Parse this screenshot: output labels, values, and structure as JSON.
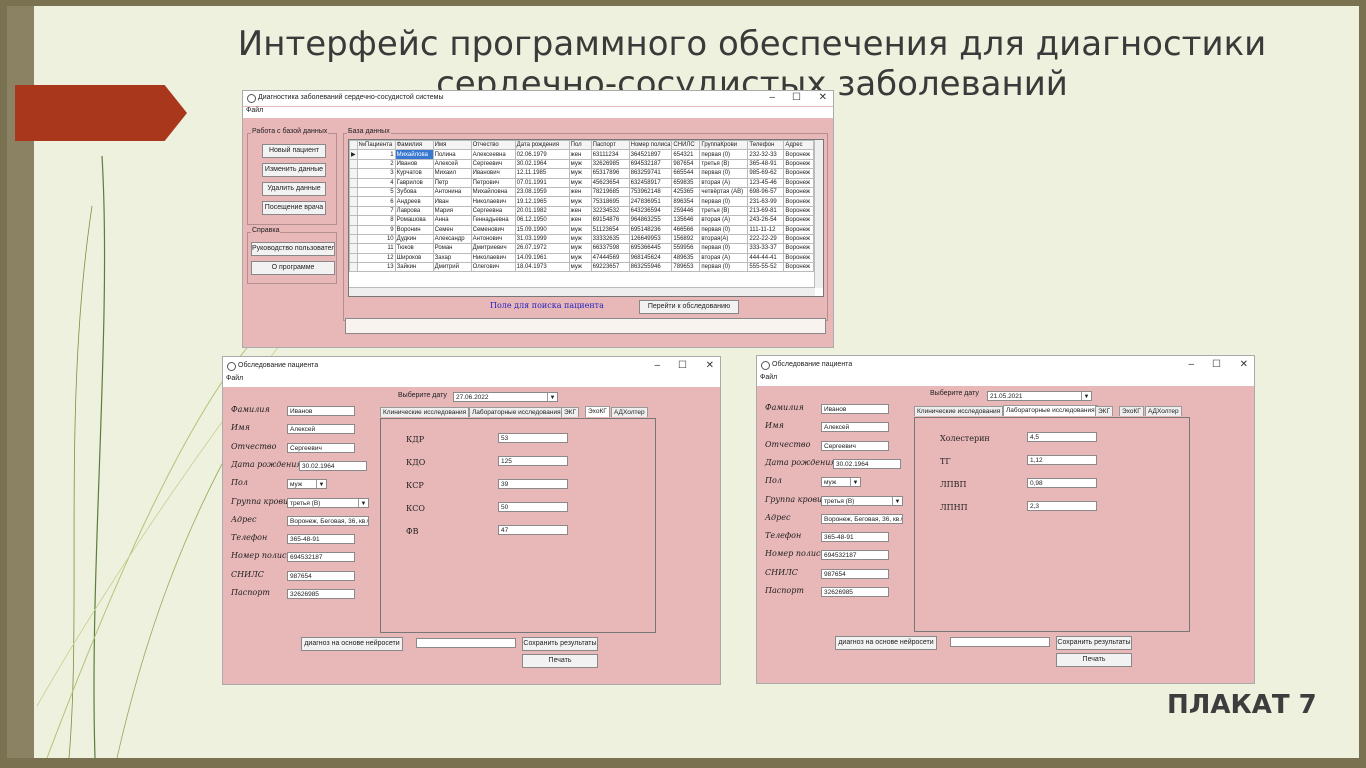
{
  "slide": {
    "title_line1": "Интерфейс программного обеспечения для диагностики",
    "title_line2": "сердечно-сосудистых заболеваний",
    "plakat": "ПЛАКАТ 7"
  },
  "main_window": {
    "title": "Диагностика заболеваний сердечно-сосудистой системы",
    "menu_file": "Файл",
    "db_group": "Работа с базой данных",
    "btn_new": "Новый пациент",
    "btn_edit": "Изменить данные",
    "btn_delete": "Удалить данные",
    "btn_visit": "Посещение врача",
    "help_group": "Справка",
    "btn_manual": "Руководство пользователя",
    "btn_about": "О программе",
    "grid_label": "База данных",
    "columns": [
      "№Пациента",
      "Фамилия",
      "Имя",
      "Отчество",
      "Дата рождения",
      "Пол",
      "Паспорт",
      "Номер полиса",
      "СНИЛС",
      "ГруппаКрови",
      "Телефон",
      "Адрес"
    ],
    "rows": [
      [
        "1",
        "Михайлова",
        "Полина",
        "Алексеевна",
        "02.06.1979",
        "жен",
        "63111234",
        "364521897",
        "654321",
        "первая (0)",
        "232-32-33",
        "Воронеж"
      ],
      [
        "2",
        "Иванов",
        "Алексей",
        "Сергеевич",
        "30.02.1964",
        "муж",
        "32626985",
        "694532187",
        "987654",
        "третья (B)",
        "365-48-91",
        "Воронеж"
      ],
      [
        "3",
        "Курчатов",
        "Михаил",
        "Иванович",
        "12.11.1985",
        "муж",
        "65317896",
        "863259741",
        "665544",
        "первая (0)",
        "985-69-62",
        "Воронеж"
      ],
      [
        "4",
        "Гаврилов",
        "Петр",
        "Петрович",
        "07.01.1991",
        "муж",
        "45623654",
        "632458917",
        "659835",
        "вторая (A)",
        "123-45-46",
        "Воронеж"
      ],
      [
        "5",
        "Зубова",
        "Антонина",
        "Михайловна",
        "23.08.1959",
        "жен",
        "78219685",
        "753962148",
        "425365",
        "четвёртая (AB)",
        "698-96-57",
        "Воронеж"
      ],
      [
        "6",
        "Андреев",
        "Иван",
        "Николаевич",
        "19.12.1965",
        "муж",
        "75318695",
        "247836951",
        "896354",
        "первая (0)",
        "231-63-99",
        "Воронеж"
      ],
      [
        "7",
        "Лаврова",
        "Мария",
        "Сергеевна",
        "20.01.1982",
        "жен",
        "32234532",
        "643236594",
        "259446",
        "третья (B)",
        "213-69-81",
        "Воронеж"
      ],
      [
        "8",
        "Ромашова",
        "Анна",
        "Геннадьевна",
        "06.12.1950",
        "жен",
        "69154876",
        "964863255",
        "135646",
        "вторая (A)",
        "243-26-54",
        "Воронеж"
      ],
      [
        "9",
        "Воронин",
        "Семен",
        "Семенович",
        "15.09.1990",
        "муж",
        "51123654",
        "695148236",
        "466566",
        "первая (0)",
        "111-11-12",
        "Воронеж"
      ],
      [
        "10",
        "Дудкин",
        "Александр",
        "Антонович",
        "31.03.1999",
        "муж",
        "33332635",
        "126649953",
        "156892",
        "вторая(A)",
        "222-22-29",
        "Воронеж"
      ],
      [
        "11",
        "Тюков",
        "Роман",
        "Дмитриевич",
        "26.07.1972",
        "муж",
        "66337598",
        "695366445",
        "559956",
        "первая (0)",
        "333-33-37",
        "Воронеж"
      ],
      [
        "12",
        "Широков",
        "Захар",
        "Николаевич",
        "14.09.1961",
        "муж",
        "47444569",
        "968145624",
        "489635",
        "вторая (A)",
        "444-44-41",
        "Воронеж"
      ],
      [
        "13",
        "Зайкин",
        "Дмитрий",
        "Олегович",
        "18.04.1973",
        "муж",
        "69223657",
        "863255946",
        "789653",
        "первая (0)",
        "555-55-52",
        "Воронеж"
      ]
    ],
    "search_label": "Поле для поиска пациента",
    "btn_goto": "Перейти к обследованию"
  },
  "exam_window_1": {
    "title": "Обследование пациента",
    "menu_file": "Файл",
    "date_label": "Выберите дату",
    "date_value": "27.06.2022",
    "labels": {
      "surname": "Фамилия",
      "name": "Имя",
      "patronymic": "Отчество",
      "birth": "Дата рождения",
      "sex": "Пол",
      "blood": "Группа крови",
      "address": "Адрес",
      "phone": "Телефон",
      "policy": "Номер полиса",
      "snils": "СНИЛС",
      "passport": "Паспорт"
    },
    "values": {
      "surname": "Иванов",
      "name": "Алексей",
      "patronymic": "Сергеевич",
      "birth": "30.02.1964",
      "sex": "муж",
      "blood": "третья (B)",
      "address": "Воронеж, Беговая, 36, кв.6",
      "phone": "365-48-91",
      "policy": "694532187",
      "snils": "987654",
      "passport": "32626985"
    },
    "tabs": [
      "Клинические исследования",
      "Лабораторные исследования",
      "ЭКГ",
      "ЭхоКГ",
      "АДХолтер"
    ],
    "active_tab": "ЭхоКГ",
    "params": [
      {
        "label": "КДР",
        "value": "53"
      },
      {
        "label": "КДО",
        "value": "125"
      },
      {
        "label": "КСР",
        "value": "39"
      },
      {
        "label": "КСО",
        "value": "50"
      },
      {
        "label": "ФВ",
        "value": "47"
      }
    ],
    "btn_nn": "диагноз на основе нейросети",
    "btn_save": "Сохранить результаты",
    "btn_print": "Печать"
  },
  "exam_window_2": {
    "title": "Обследование пациента",
    "menu_file": "Файл",
    "date_label": "Выберите дату",
    "date_value": "21.05.2021",
    "tabs": [
      "Клинические исследования",
      "Лабораторные исследования",
      "ЭКГ",
      "ЭхоКГ",
      "АДХолтер"
    ],
    "active_tab": "Лабораторные исследования",
    "params": [
      {
        "label": "Холестерин",
        "value": "4,5"
      },
      {
        "label": "ТГ",
        "value": "1,12"
      },
      {
        "label": "ЛПВП",
        "value": "0,98"
      },
      {
        "label": "ЛПНП",
        "value": "2,3"
      }
    ],
    "btn_nn": "диагноз на основе нейросети",
    "btn_save": "Сохранить результаты",
    "btn_print": "Печать"
  },
  "window_controls": {
    "min": "–",
    "max": "☐",
    "close": "✕"
  }
}
